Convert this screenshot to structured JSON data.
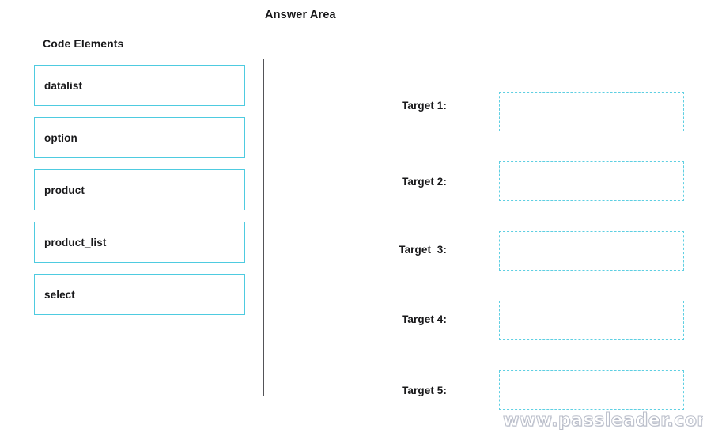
{
  "answer_area": {
    "title": "Answer Area"
  },
  "code_elements": {
    "heading": "Code Elements",
    "items": [
      {
        "label": "datalist"
      },
      {
        "label": "option"
      },
      {
        "label": "product"
      },
      {
        "label": "product_list"
      },
      {
        "label": "select"
      }
    ]
  },
  "targets": [
    {
      "label": "Target 1:",
      "value": ""
    },
    {
      "label": "Target 2:",
      "value": ""
    },
    {
      "label": "Target  3:",
      "value": ""
    },
    {
      "label": "Target 4:",
      "value": ""
    },
    {
      "label": "Target 5:",
      "value": ""
    }
  ],
  "watermark": {
    "text": "www.passleader.com"
  },
  "colors": {
    "tile_border": "#4ecbe0",
    "drop_border": "#5ecfe2",
    "divider": "#545458",
    "text": "#18181a",
    "background": "#ffffff",
    "watermark": "#b9bdc9"
  }
}
